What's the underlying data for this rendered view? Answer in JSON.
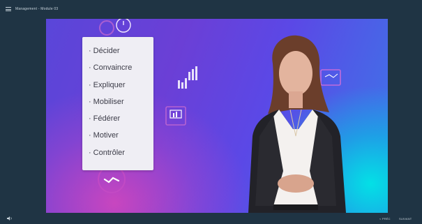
{
  "header": {
    "module_title": "Management - Module 03"
  },
  "slide": {
    "words": [
      "Décider",
      "Convaincre",
      "Expliquer",
      "Mobiliser",
      "Fédérer",
      "Motiver",
      "Contrôler"
    ]
  },
  "footer": {
    "prev_label": "< PRÉC",
    "next_label": "SUIVANT"
  },
  "colors": {
    "chrome": "#1f3444",
    "stage_blue": "#5a46d9",
    "stage_magenta": "#cd46be",
    "stage_cyan": "#00e6e6",
    "card": "#efeef4",
    "text_light": "#c9d4dc"
  },
  "icons": [
    "menu-icon",
    "timer-icon",
    "gear-icon",
    "chart-icon",
    "presentation-icon",
    "handshake-icon",
    "sound-icon"
  ]
}
